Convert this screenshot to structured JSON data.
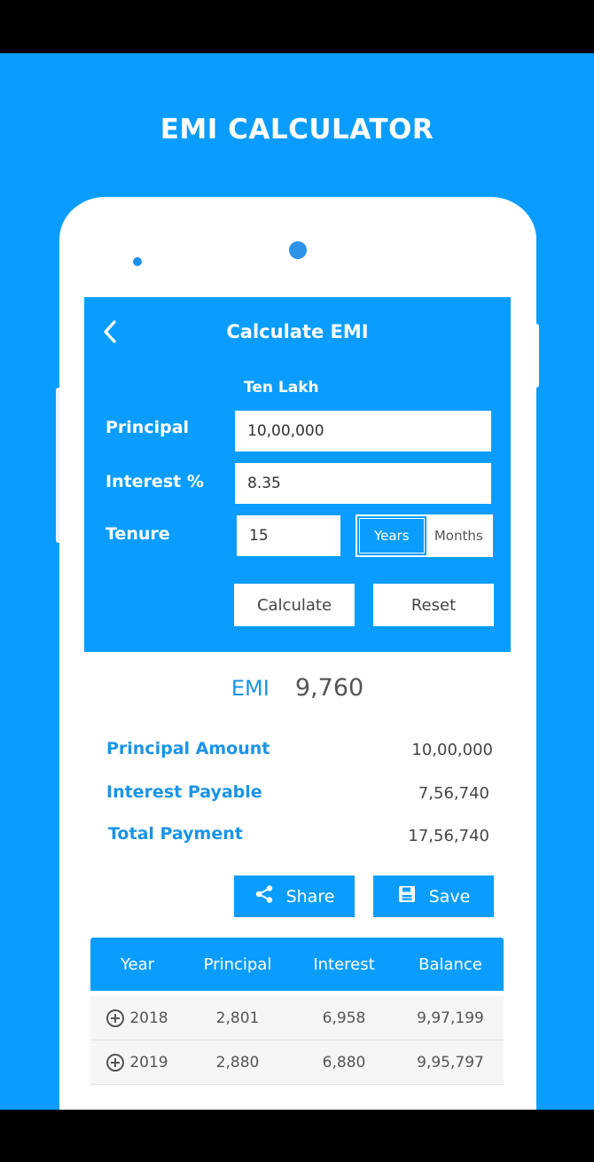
{
  "promo": {
    "title": "EMI CALCULATOR"
  },
  "header": {
    "title": "Calculate EMI"
  },
  "form": {
    "amount_in_words": "Ten Lakh",
    "principal_label": "Principal",
    "principal_value": "10,00,000",
    "interest_label": "Interest %",
    "interest_value": "8.35",
    "tenure_label": "Tenure",
    "tenure_value": "15",
    "unit_years": "Years",
    "unit_months": "Months",
    "selected_unit": "Years",
    "calculate_label": "Calculate",
    "reset_label": "Reset"
  },
  "result": {
    "emi_label": "EMI",
    "emi_value": "9,760",
    "principal_amount_label": "Principal Amount",
    "principal_amount_value": "10,00,000",
    "interest_payable_label": "Interest Payable",
    "interest_payable_value": "7,56,740",
    "total_payment_label": "Total Payment",
    "total_payment_value": "17,56,740"
  },
  "actions": {
    "share_label": "Share",
    "save_label": "Save"
  },
  "table": {
    "headers": [
      "Year",
      "Principal",
      "Interest",
      "Balance"
    ],
    "rows": [
      [
        "2018",
        "2,801",
        "6,958",
        "9,97,199"
      ],
      [
        "2019",
        "2,880",
        "6,880",
        "9,95,797"
      ]
    ]
  },
  "colors": {
    "accent": "#0a9dff",
    "label_blue": "#1a94e8"
  },
  "icons": {
    "back": "chevron-left-icon",
    "share": "share-icon",
    "save": "save-icon",
    "expand": "plus-circle-icon"
  }
}
